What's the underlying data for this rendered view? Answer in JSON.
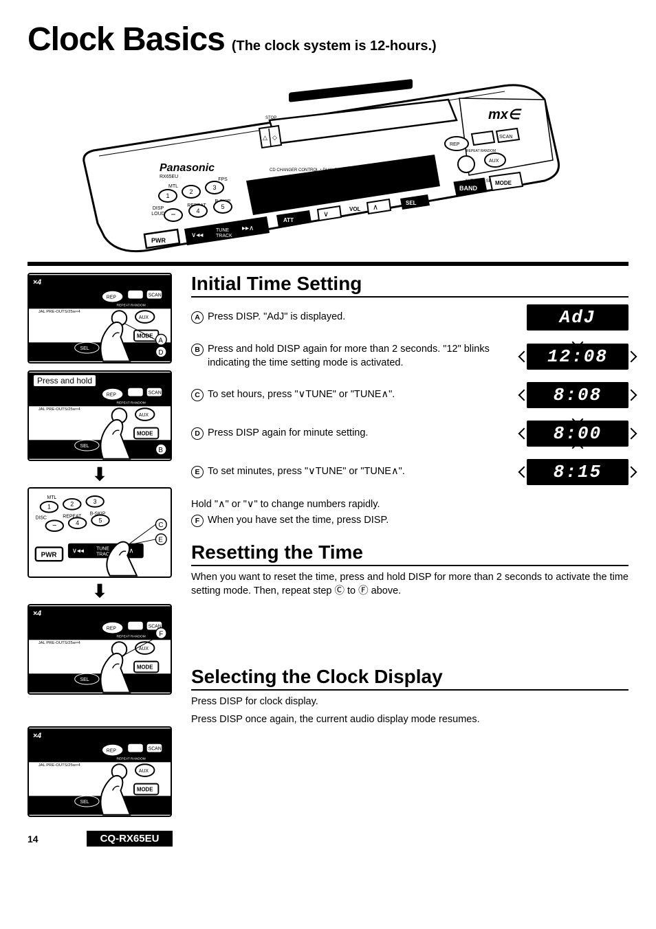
{
  "title": {
    "main": "Clock Basics",
    "sub": "(The clock system is 12-hours.)"
  },
  "hero": {
    "brand": "Panasonic",
    "model_small": "RX65EU",
    "logo_right": "mx∈",
    "power_spec": "25w×4",
    "pwr": "PWR",
    "tune_track": "TUNE\nTRACK",
    "att": "ATT",
    "vol": "VOL",
    "sel": "SEL",
    "band": "BAND",
    "mode": "MODE",
    "aux": "AUX",
    "rep": "REP",
    "scan": "SCAN",
    "repeat_random": "REPEAT RANDOM",
    "cd_changer": "CD CHANGER CONTROL・DUAL PRE-OUTS",
    "disp": "DISP",
    "loud": "LOUD",
    "mtl": "MTL",
    "fps": "FPS",
    "repeat": "REPEAT",
    "bskp": "B-SKIP",
    "stop": "STOP",
    "auto_preset": "AUTO PRESET"
  },
  "thumbs": {
    "press_hold": "Press and hold",
    "labels": [
      "A",
      "D",
      "B",
      "C",
      "E",
      "F"
    ]
  },
  "sections": {
    "initial": {
      "heading": "Initial Time Setting",
      "steps": {
        "a": "Press DISP. \"AdJ\" is displayed.",
        "b": "Press and hold DISP again for more than 2 seconds. \"12\" blinks indicating the time setting mode is activated.",
        "c": "To set hours, press \"∨TUNE\" or \"TUNE∧\".",
        "d": "Press DISP again for minute setting.",
        "e": "To set minutes, press \"∨TUNE\" or \"TUNE∧\"."
      },
      "lcds": {
        "a": "AdJ",
        "b": "12:08",
        "c": "8:08",
        "d": "8:00",
        "e": "8:15"
      },
      "note1": "Hold \"∧\" or \"∨\" to change numbers rapidly.",
      "note2_label": "F",
      "note2": "When you have set the time, press DISP."
    },
    "resetting": {
      "heading": "Resetting the Time",
      "body": "When you want to reset the time, press and hold DISP for more than 2 seconds to activate the time setting mode. Then, repeat step Ⓒ to Ⓕ above."
    },
    "selecting": {
      "heading": "Selecting the Clock Display",
      "line1": "Press DISP for clock display.",
      "line2": "Press DISP once again, the current audio display mode resumes."
    }
  },
  "footer": {
    "page": "14",
    "model": "CQ-RX65EU"
  }
}
